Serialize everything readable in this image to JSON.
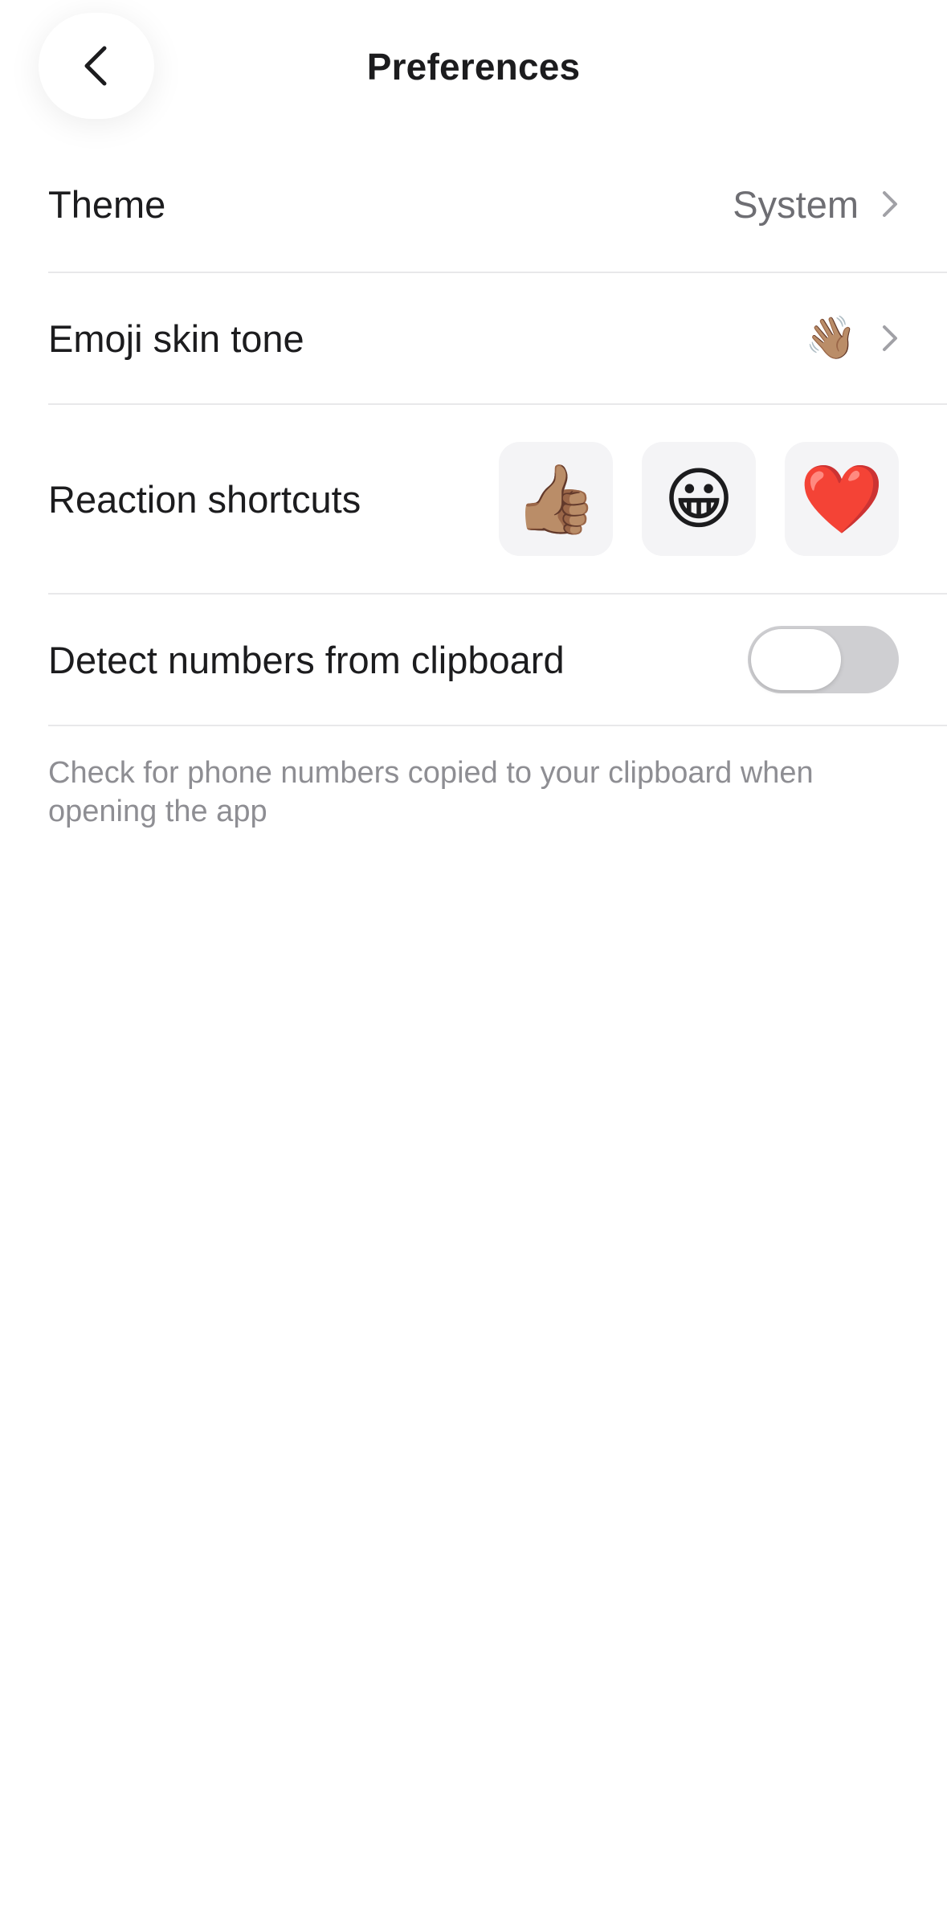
{
  "header": {
    "title": "Preferences",
    "back_icon": "chevron-left-icon"
  },
  "rows": {
    "theme": {
      "label": "Theme",
      "value": "System"
    },
    "skin_tone": {
      "label": "Emoji skin tone",
      "value": "👋🏽"
    },
    "reactions": {
      "label": "Reaction shortcuts",
      "items": [
        "👍🏽",
        "😀",
        "❤️"
      ]
    },
    "detect": {
      "label": "Detect numbers from clipboard",
      "enabled": false,
      "description": "Check for phone numbers copied to your clipboard when opening the app"
    }
  },
  "colors": {
    "text": "#1c1c1e",
    "secondary_text": "#6e6e73",
    "footnote": "#8e8e93",
    "toggle_off": "#cfcfd2",
    "tile_bg": "#f4f4f6",
    "divider": "#e8e8ea"
  }
}
